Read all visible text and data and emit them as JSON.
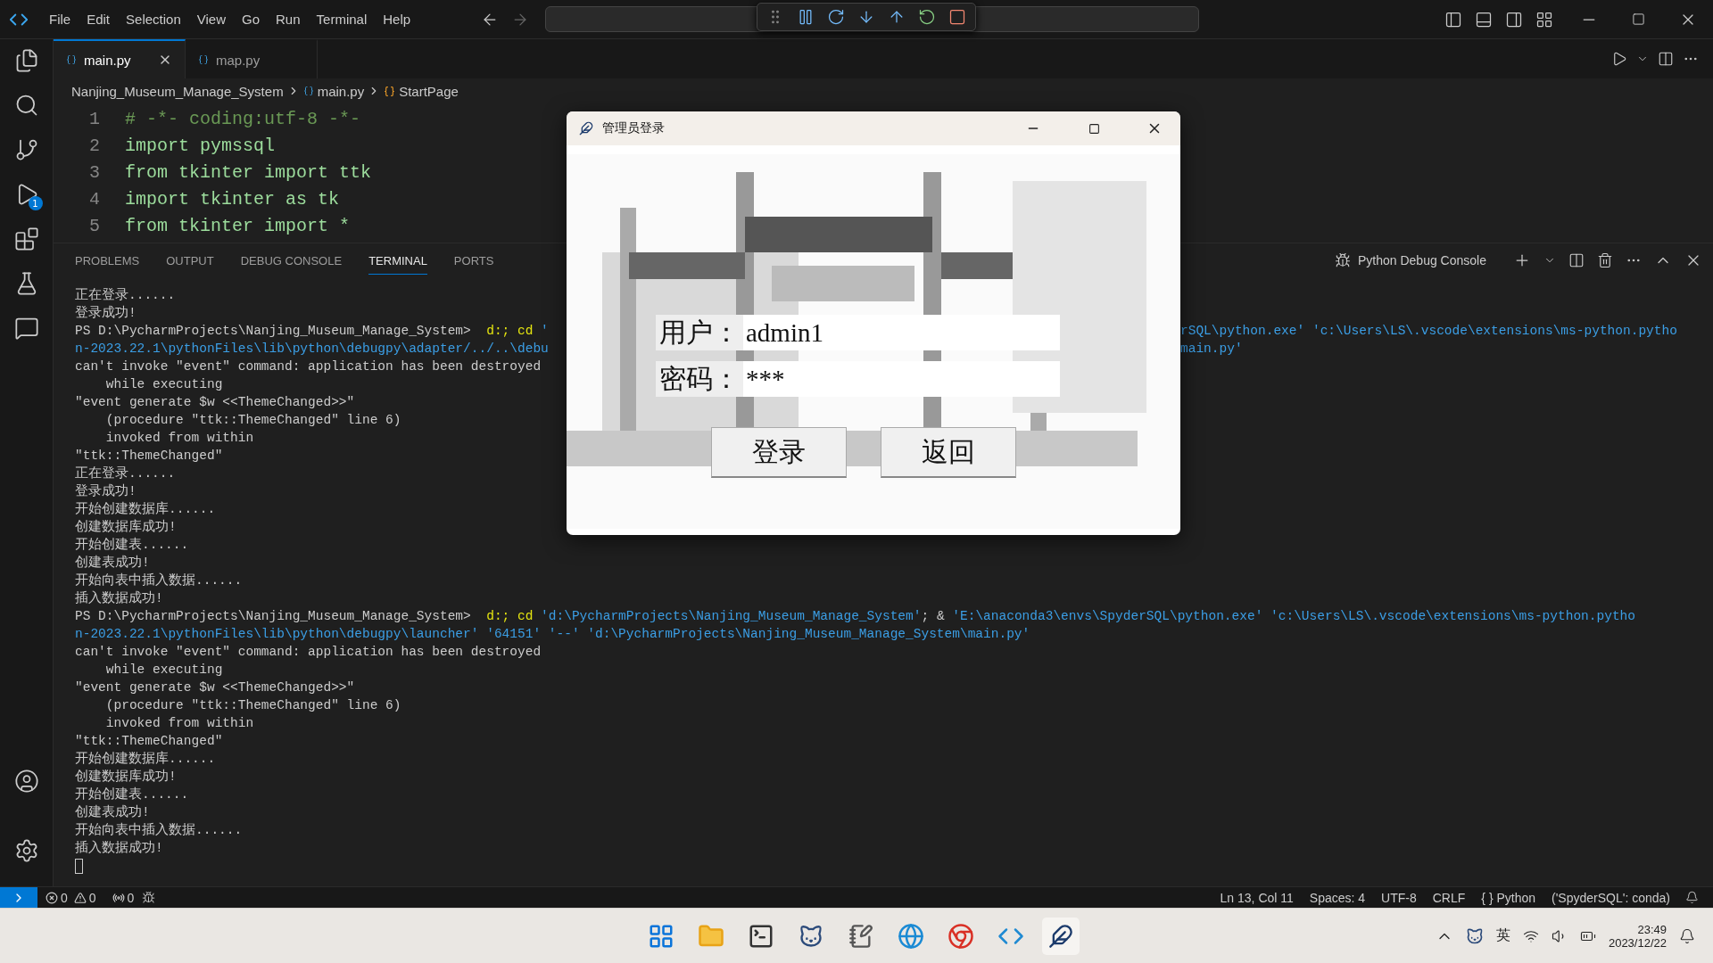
{
  "titlebar": {
    "menu": [
      "File",
      "Edit",
      "Selection",
      "View",
      "Go",
      "Run",
      "Terminal",
      "Help"
    ]
  },
  "activity_bar": {
    "debug_badge": "1"
  },
  "editor": {
    "tabs": [
      {
        "label": "main.py",
        "selected": true
      },
      {
        "label": "map.py",
        "selected": false
      }
    ],
    "breadcrumb": [
      "Nanjing_Museum_Manage_System",
      "main.py",
      "StartPage"
    ],
    "lines": [
      {
        "number": "1",
        "kind": "comment",
        "text": "# -*- coding:utf-8 -*-"
      },
      {
        "number": "2",
        "kind": "code",
        "text": "import pymssql"
      },
      {
        "number": "3",
        "kind": "code",
        "text": "from tkinter import ttk"
      },
      {
        "number": "4",
        "kind": "code",
        "text": "import tkinter as tk"
      },
      {
        "number": "5",
        "kind": "code",
        "text": "from tkinter import *"
      }
    ]
  },
  "panel": {
    "tabs": [
      {
        "label": "PROBLEMS",
        "selected": false
      },
      {
        "label": "OUTPUT",
        "selected": false
      },
      {
        "label": "DEBUG CONSOLE",
        "selected": false
      },
      {
        "label": "TERMINAL",
        "selected": true
      },
      {
        "label": "PORTS",
        "selected": false
      }
    ],
    "terminal_name": "Python Debug Console",
    "lines": [
      {
        "spans": [
          {
            "kind": "plain",
            "text": "正在登录......"
          }
        ]
      },
      {
        "spans": [
          {
            "kind": "plain",
            "text": "登录成功!"
          }
        ]
      },
      {
        "spans": [
          {
            "kind": "plain",
            "text": "PS D:\\PycharmProjects\\Nanjing_Museum_Manage_System>  "
          },
          {
            "kind": "command",
            "text": "d:; cd "
          },
          {
            "kind": "string",
            "text": "'"
          }
        ],
        "right_spans": [
          {
            "kind": "string",
            "text": "rSQL\\python.exe' 'c:\\Users\\LS\\.vscode\\extensions\\ms-python.pytho"
          }
        ]
      },
      {
        "spans": [
          {
            "kind": "string",
            "text": "n-2023.22.1\\pythonFiles\\lib\\python\\debugpy\\adapter/../..\\debu"
          }
        ],
        "right_spans": [
          {
            "kind": "string",
            "text": "main.py'"
          }
        ]
      },
      {
        "spans": [
          {
            "kind": "plain",
            "text": "can't invoke \"event\" command: application has been destroyed"
          }
        ]
      },
      {
        "spans": [
          {
            "kind": "plain",
            "text": "    while executing"
          }
        ]
      },
      {
        "spans": [
          {
            "kind": "plain",
            "text": "\"event generate $w <<ThemeChanged>>\""
          }
        ]
      },
      {
        "spans": [
          {
            "kind": "plain",
            "text": "    (procedure \"ttk::ThemeChanged\" line 6)"
          }
        ]
      },
      {
        "spans": [
          {
            "kind": "plain",
            "text": "    invoked from within"
          }
        ]
      },
      {
        "spans": [
          {
            "kind": "plain",
            "text": "\"ttk::ThemeChanged\""
          }
        ]
      },
      {
        "spans": [
          {
            "kind": "plain",
            "text": "正在登录......"
          }
        ]
      },
      {
        "spans": [
          {
            "kind": "plain",
            "text": "登录成功!"
          }
        ]
      },
      {
        "spans": [
          {
            "kind": "plain",
            "text": "开始创建数据库......"
          }
        ]
      },
      {
        "spans": [
          {
            "kind": "plain",
            "text": "创建数据库成功!"
          }
        ]
      },
      {
        "spans": [
          {
            "kind": "plain",
            "text": "开始创建表......"
          }
        ]
      },
      {
        "spans": [
          {
            "kind": "plain",
            "text": "创建表成功!"
          }
        ]
      },
      {
        "spans": [
          {
            "kind": "plain",
            "text": "开始向表中插入数据......"
          }
        ]
      },
      {
        "spans": [
          {
            "kind": "plain",
            "text": "插入数据成功!"
          }
        ]
      },
      {
        "spans": [
          {
            "kind": "plain",
            "text": "PS D:\\PycharmProjects\\Nanjing_Museum_Manage_System>  "
          },
          {
            "kind": "command",
            "text": "d:; cd "
          },
          {
            "kind": "string",
            "text": "'d:\\PycharmProjects\\Nanjing_Museum_Manage_System'"
          },
          {
            "kind": "plain",
            "text": "; & "
          },
          {
            "kind": "string",
            "text": "'E:\\anaconda3\\envs\\SpyderSQL\\python.exe' 'c:\\Users\\LS\\.vscode\\extensions\\ms-python.pytho"
          }
        ]
      },
      {
        "spans": [
          {
            "kind": "string",
            "text": "n-2023.22.1\\pythonFiles\\lib\\python\\debugpy\\launcher' '64151' '--' 'd:\\PycharmProjects\\Nanjing_Museum_Manage_System\\main.py'"
          }
        ]
      },
      {
        "spans": [
          {
            "kind": "plain",
            "text": "can't invoke \"event\" command: application has been destroyed"
          }
        ]
      },
      {
        "spans": [
          {
            "kind": "plain",
            "text": "    while executing"
          }
        ]
      },
      {
        "spans": [
          {
            "kind": "plain",
            "text": "\"event generate $w <<ThemeChanged>>\""
          }
        ]
      },
      {
        "spans": [
          {
            "kind": "plain",
            "text": "    (procedure \"ttk::ThemeChanged\" line 6)"
          }
        ]
      },
      {
        "spans": [
          {
            "kind": "plain",
            "text": "    invoked from within"
          }
        ]
      },
      {
        "spans": [
          {
            "kind": "plain",
            "text": "\"ttk::ThemeChanged\""
          }
        ]
      },
      {
        "spans": [
          {
            "kind": "plain",
            "text": "开始创建数据库......"
          }
        ]
      },
      {
        "spans": [
          {
            "kind": "plain",
            "text": "创建数据库成功!"
          }
        ]
      },
      {
        "spans": [
          {
            "kind": "plain",
            "text": "开始创建表......"
          }
        ]
      },
      {
        "spans": [
          {
            "kind": "plain",
            "text": "创建表成功!"
          }
        ]
      },
      {
        "spans": [
          {
            "kind": "plain",
            "text": "开始向表中插入数据......"
          }
        ]
      },
      {
        "spans": [
          {
            "kind": "plain",
            "text": "插入数据成功!"
          }
        ]
      }
    ]
  },
  "dialog": {
    "title": "管理员登录",
    "fields": [
      {
        "label": "用户：",
        "value": "admin1"
      },
      {
        "label": "密码：",
        "value": "***"
      }
    ],
    "buttons": [
      "登录",
      "返回"
    ]
  },
  "status_bar": {
    "errors": "0",
    "warnings": "0",
    "ports": "0",
    "items": [
      "Ln 13, Col 11",
      "Spaces: 4",
      "UTF-8",
      "CRLF",
      "{ } Python",
      "('SpyderSQL': conda)"
    ]
  },
  "taskbar": {
    "ime": "英",
    "time": "23:49",
    "date": "2023/12/22"
  }
}
